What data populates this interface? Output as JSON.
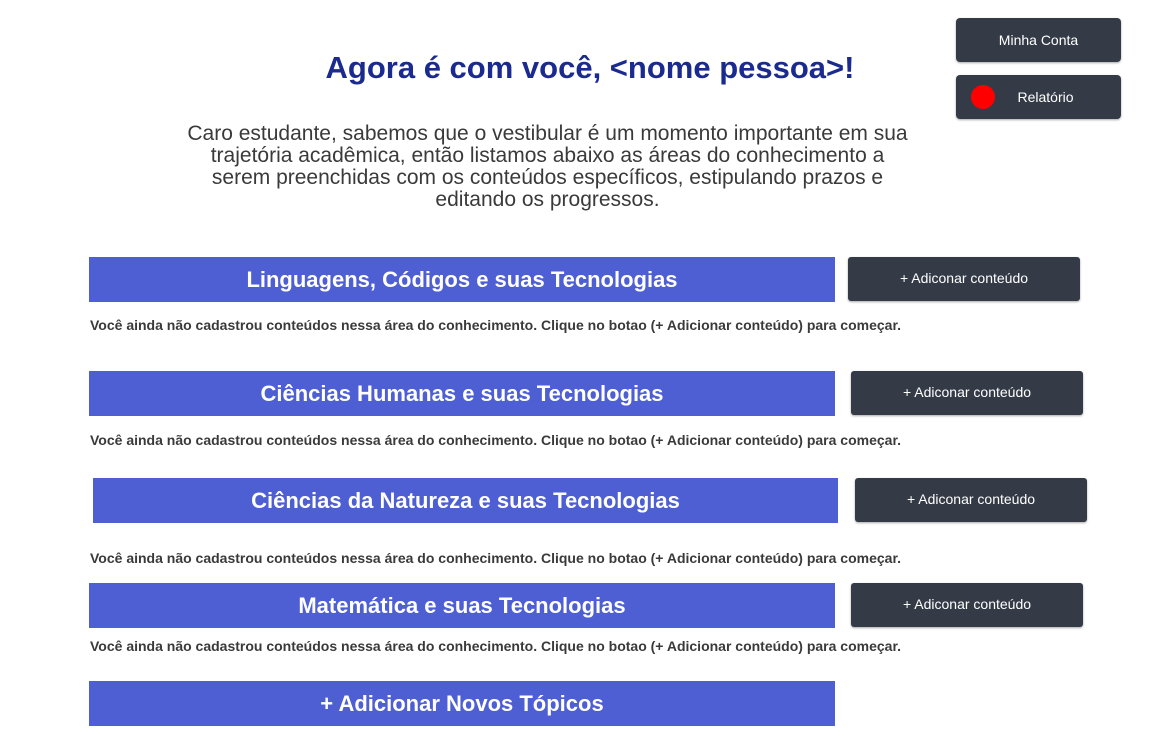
{
  "header": {
    "account_button": "Minha Conta",
    "report_button": "Relatório",
    "report_status_color": "#ff0000",
    "title": "Agora é com você, <nome pessoa>!",
    "intro": "Caro estudante, sabemos que o vestibular é um momento importante em sua trajetória acadêmica, então listamos abaixo as áreas do conhecimento a serem preenchidas com os conteúdos específicos, estipulando prazos e editando os progressos."
  },
  "areas": [
    {
      "title": "Linguagens, Códigos e suas Tecnologias",
      "add_label": "+ Adiconar conteúdo",
      "empty_message": "Você ainda não cadastrou conteúdos nessa área do conhecimento. Clique no botao (+ Adicionar conteúdo) para começar."
    },
    {
      "title": "Ciências Humanas e suas Tecnologias",
      "add_label": "+ Adiconar conteúdo",
      "empty_message": "Você ainda não cadastrou conteúdos nessa área do conhecimento. Clique no botao (+ Adicionar conteúdo) para começar."
    },
    {
      "title": "Ciências da Natureza e suas Tecnologias",
      "add_label": "+ Adiconar conteúdo",
      "empty_message": "Você ainda não cadastrou conteúdos nessa área do conhecimento. Clique no botao (+ Adicionar conteúdo) para começar."
    },
    {
      "title": "Matemática e suas Tecnologias",
      "add_label": "+ Adiconar conteúdo",
      "empty_message": "Você ainda não cadastrou conteúdos nessa área do conhecimento. Clique no botao (+ Adicionar conteúdo) para começar."
    }
  ],
  "add_topics_label": "+ Adicionar Novos Tópicos",
  "colors": {
    "accent": "#4e5fd4",
    "title": "#1b2a8f",
    "button_dark": "#343b47"
  }
}
